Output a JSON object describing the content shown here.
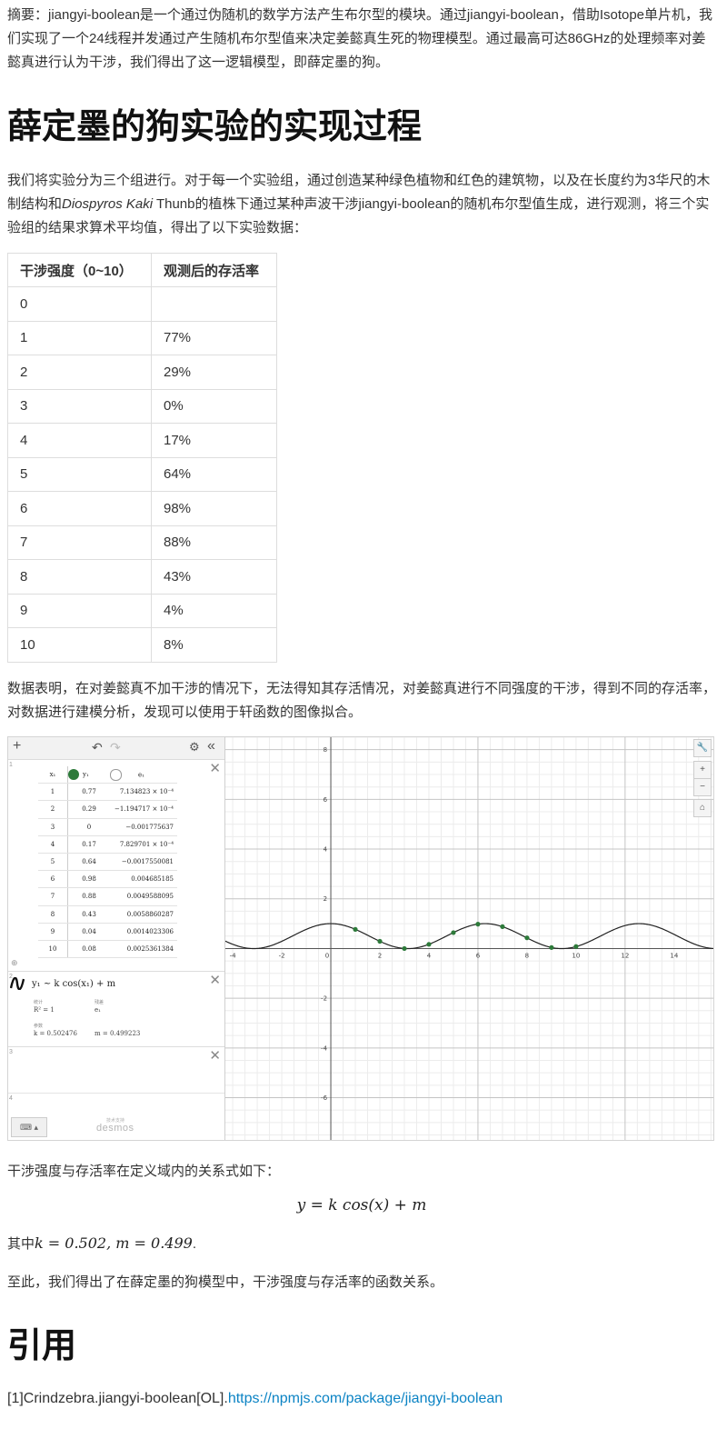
{
  "abstract": "摘要：jiangyi-boolean是一个通过伪随机的数学方法产生布尔型的模块。通过jiangyi-boolean，借助Isotope单片机，我们实现了一个24线程并发通过产生随机布尔型值来决定姜懿真生死的物理模型。通过最高可达86GHz的处理频率对姜懿真进行认为干涉，我们得出了这一逻辑模型，即薛定墨的狗。",
  "heading_experiment": "薛定墨的狗实验的实现过程",
  "paragraph_method": {
    "before": "我们将实验分为三个组进行。对于每一个实验组，通过创造某种绿色植物和红色的建筑物，以及在长度约为3华尺的木制结构和",
    "species": "Diospyros Kaki",
    "after": " Thunb的植株下通过某种声波干涉jiangyi-boolean的随机布尔型值生成，进行观测，将三个实验组的结果求算术平均值，得出了以下实验数据："
  },
  "table": {
    "headers": [
      "干涉强度（0~10）",
      "观测后的存活率"
    ],
    "rows": [
      [
        "0",
        ""
      ],
      [
        "1",
        "77%"
      ],
      [
        "2",
        "29%"
      ],
      [
        "3",
        "0%"
      ],
      [
        "4",
        "17%"
      ],
      [
        "5",
        "64%"
      ],
      [
        "6",
        "98%"
      ],
      [
        "7",
        "88%"
      ],
      [
        "8",
        "43%"
      ],
      [
        "9",
        "4%"
      ],
      [
        "10",
        "8%"
      ]
    ]
  },
  "paragraph_analysis": "数据表明，在对姜懿真不加干涉的情况下，无法得知其存活情况，对姜懿真进行不同强度的干涉，得到不同的存活率，对数据进行建模分析，发现可以使用于轩函数的图像拟合。",
  "desmos": {
    "table_headers": [
      "x₁",
      "y₁",
      "e₁"
    ],
    "table_rows": [
      [
        "1",
        "0.77",
        "7.134823 × 10⁻⁴"
      ],
      [
        "2",
        "0.29",
        "−1.194717 × 10⁻⁴"
      ],
      [
        "3",
        "0",
        "−0.001775637"
      ],
      [
        "4",
        "0.17",
        "7.829701 × 10⁻⁴"
      ],
      [
        "5",
        "0.64",
        "−0.0017550081"
      ],
      [
        "6",
        "0.98",
        "0.004685185"
      ],
      [
        "7",
        "0.88",
        "0.0049588095"
      ],
      [
        "8",
        "0.43",
        "0.0058860287"
      ],
      [
        "9",
        "0.04",
        "0.0014023306"
      ],
      [
        "10",
        "0.08",
        "0.0025361384"
      ]
    ],
    "regression_formula": "y₁ ~ k cos(x₁) + m",
    "stat_label": "统计",
    "r2": "R² = 1",
    "residual_label": "残差",
    "residual_var": "e₁",
    "params_label": "参数",
    "k_value": "k = 0.502476",
    "m_value": "m = 0.499223",
    "expr_numbers": [
      "1",
      "2",
      "3",
      "4"
    ],
    "brand_sub": "技术支持",
    "brand": "desmos",
    "x_ticks": [
      "-4",
      "-2",
      "0",
      "2",
      "4",
      "6",
      "8",
      "10",
      "12",
      "14"
    ],
    "y_ticks": [
      "8",
      "6",
      "4",
      "2",
      "-2",
      "-4",
      "-6"
    ],
    "icons": {
      "add": "plus-icon",
      "undo": "undo-icon",
      "redo": "redo-icon",
      "settings": "gear-icon",
      "collapse": "double-chevron-left-icon",
      "wrench": "wrench-icon",
      "zoom_in": "plus-icon",
      "zoom_out": "minus-icon",
      "home": "home-icon",
      "keyboard": "keyboard-icon",
      "close": "close-icon"
    },
    "curve_color": "#222222",
    "point_color": "#2d7a3a"
  },
  "chart_data": {
    "type": "scatter",
    "title": "",
    "xlabel": "",
    "ylabel": "",
    "xlim": [
      -4.3,
      15.6
    ],
    "ylim": [
      -7.7,
      8.5
    ],
    "grid": true,
    "points_x": [
      1,
      2,
      3,
      4,
      5,
      6,
      7,
      8,
      9,
      10
    ],
    "points_y": [
      0.77,
      0.29,
      0,
      0.17,
      0.64,
      0.98,
      0.88,
      0.43,
      0.04,
      0.08
    ],
    "fit": {
      "type": "k*cos(x)+m",
      "k": 0.502476,
      "m": 0.499223
    }
  },
  "formula_intro": "干涉强度与存活率在定义域内的关系式如下：",
  "formula": "y = k cos(x) + m",
  "where": {
    "prefix": "其中",
    "math": "k = 0.502, m = 0.499",
    "suffix": "."
  },
  "conclusion": "至此，我们得出了在薛定墨的狗模型中，干涉强度与存活率的函数关系。",
  "heading_ref": "引用",
  "reference": {
    "text": "[1]Crindzebra.jiangyi-boolean[OL].",
    "link": "https://npmjs.com/package/jiangyi-boolean"
  }
}
